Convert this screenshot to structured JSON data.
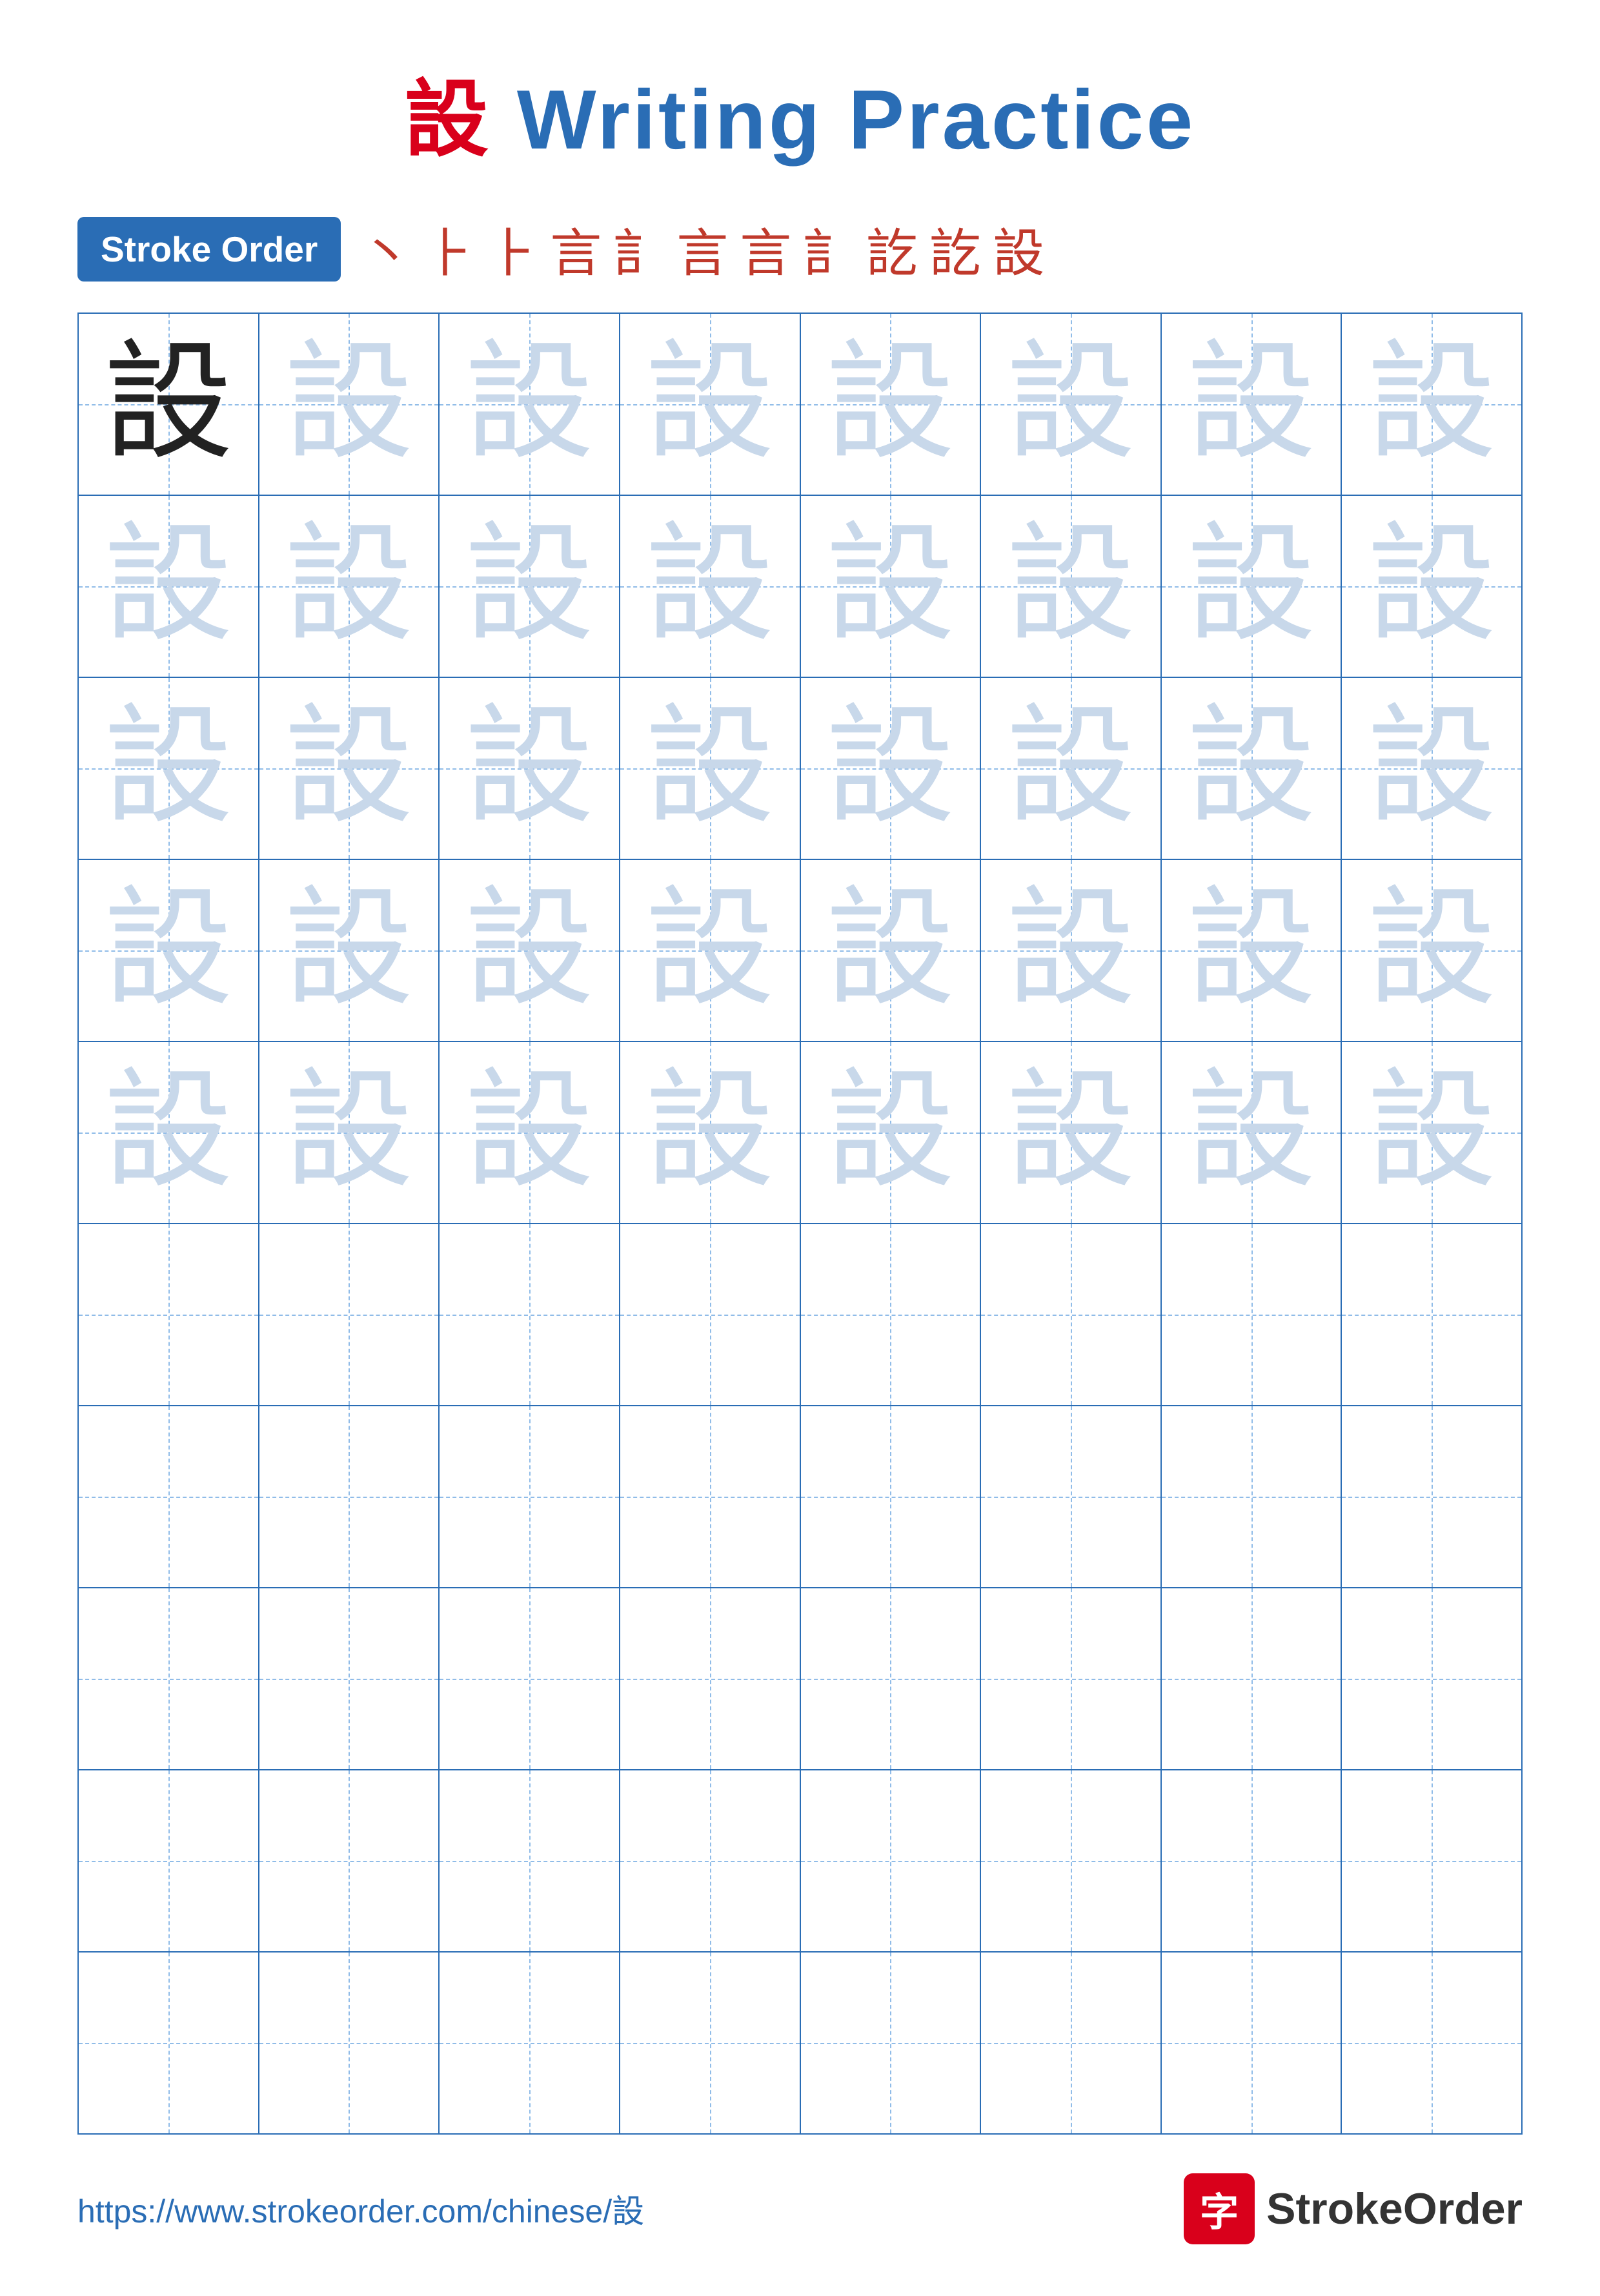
{
  "title": {
    "char": "設",
    "rest": " Writing Practice"
  },
  "stroke_order": {
    "badge_label": "Stroke Order",
    "chars": [
      "丶",
      "⺊",
      "⺊",
      "言",
      "訁",
      "言",
      "言",
      "訁",
      "訖",
      "訖",
      "設"
    ]
  },
  "grid": {
    "rows": 10,
    "cols": 8,
    "practice_char": "設",
    "filled_rows": 5,
    "first_cell_dark": true
  },
  "footer": {
    "url": "https://www.strokeorder.com/chinese/設",
    "logo_char": "字",
    "logo_text_blue": "Stroke",
    "logo_text_dark": "Order"
  }
}
